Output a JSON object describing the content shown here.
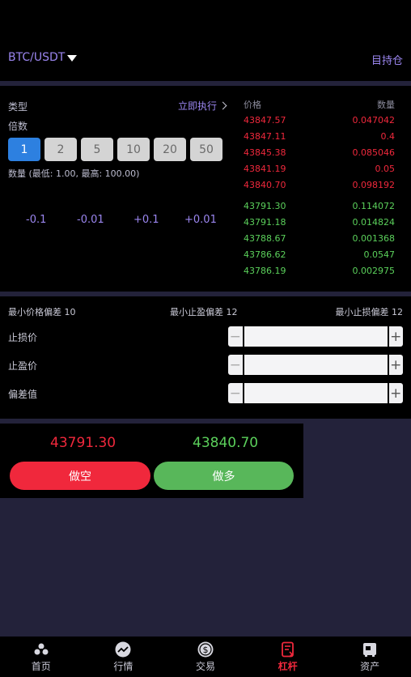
{
  "header": {
    "pair": "BTC/USDT",
    "holdings_link": "目持仓"
  },
  "order": {
    "type_label": "类型",
    "execute_label": "立即执行",
    "leverage_label": "倍数",
    "leverage_options": [
      "1",
      "2",
      "5",
      "10",
      "20",
      "50"
    ],
    "selected_leverage": "1",
    "quantity_label": "数量 (最低: 1.00, 最高: 100.00)",
    "adjust_buttons": [
      "-0.1",
      "-0.01",
      "+0.1",
      "+0.01"
    ]
  },
  "orderbook": {
    "price_header": "价格",
    "qty_header": "数量",
    "asks": [
      {
        "price": "43847.57",
        "qty": "0.047042"
      },
      {
        "price": "43847.11",
        "qty": "0.4"
      },
      {
        "price": "43845.38",
        "qty": "0.085046"
      },
      {
        "price": "43841.19",
        "qty": "0.05"
      },
      {
        "price": "43840.70",
        "qty": "0.098192"
      }
    ],
    "bids": [
      {
        "price": "43791.30",
        "qty": "0.114072"
      },
      {
        "price": "43791.18",
        "qty": "0.014824"
      },
      {
        "price": "43788.67",
        "qty": "0.001368"
      },
      {
        "price": "43786.62",
        "qty": "0.0547"
      },
      {
        "price": "43786.19",
        "qty": "0.002975"
      }
    ]
  },
  "limits": {
    "min_price_diff": "最小价格偏差 10",
    "min_tp_diff": "最小止盈偏差 12",
    "min_sl_diff": "最小止损偏差 12",
    "stop_loss_label": "止损价",
    "take_profit_label": "止盈价",
    "deviation_label": "偏差值",
    "minus": "−",
    "plus": "+"
  },
  "trade": {
    "short_price": "43791.30",
    "long_price": "43840.70",
    "short_label": "做空",
    "long_label": "做多"
  },
  "colors": {
    "accent": "#9b86f0",
    "ask": "#f0283c",
    "bid": "#5bd05b",
    "active_leverage": "#2d80e0"
  },
  "nav": {
    "items": [
      {
        "label": "首页",
        "icon": "home-icon"
      },
      {
        "label": "行情",
        "icon": "market-icon"
      },
      {
        "label": "交易",
        "icon": "trade-icon"
      },
      {
        "label": "杠杆",
        "icon": "leverage-icon"
      },
      {
        "label": "资产",
        "icon": "assets-icon"
      }
    ],
    "active": "杠杆"
  }
}
